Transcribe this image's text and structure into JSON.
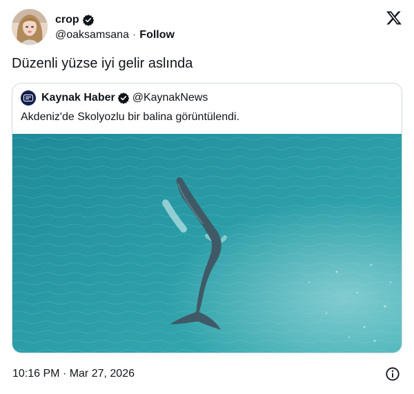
{
  "author": {
    "name": "crop",
    "handle": "@oaksamsana",
    "separator": "·",
    "follow_label": "Follow"
  },
  "tweet": {
    "text": "Düzenli yüzse iyi gelir aslında"
  },
  "quoted": {
    "name": "Kaynak Haber",
    "handle": "@KaynakNews",
    "text": "Akdeniz'de Skolyozlu bir balina görüntülendi.",
    "media_subject": "whale-swimming-in-sea"
  },
  "footer": {
    "timestamp": "10:16 PM · Mar 27, 2026"
  },
  "icons": {
    "verified": "verified-badge-icon",
    "brand": "x-logo-icon",
    "info": "info-icon"
  },
  "colors": {
    "text": "#0f1419",
    "secondary": "#536471",
    "border": "#cfd9de",
    "sea": "#2a9aa6"
  }
}
